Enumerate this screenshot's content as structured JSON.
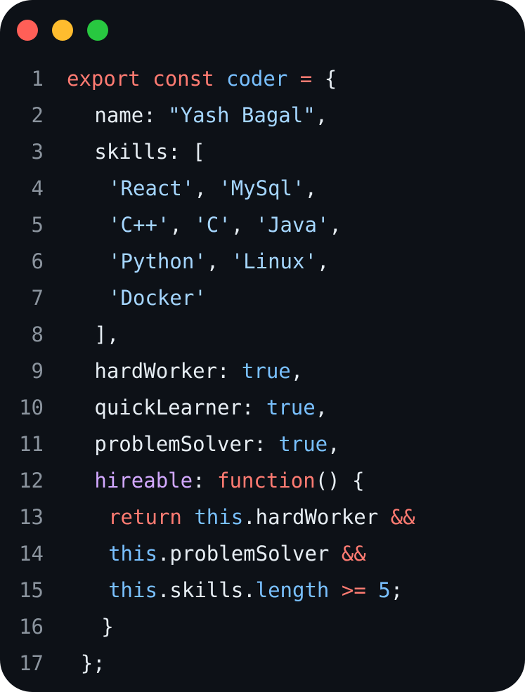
{
  "window": {
    "controls": [
      {
        "name": "close-button",
        "color": "#ff5f57"
      },
      {
        "name": "minimize-button",
        "color": "#febc2e"
      },
      {
        "name": "maximize-button",
        "color": "#28c840"
      }
    ]
  },
  "colors": {
    "keyword": "#ff7b72",
    "identifier": "#79c0ff",
    "property": "#e6edf3",
    "string": "#a5d6ff",
    "purple": "#d2a8ff",
    "text": "#e6edf3"
  },
  "code": {
    "lines": [
      {
        "num": "1",
        "indent": 0,
        "tokens": [
          {
            "t": "export",
            "c": "keyword"
          },
          {
            "t": " ",
            "c": "text"
          },
          {
            "t": "const",
            "c": "keyword"
          },
          {
            "t": " ",
            "c": "text"
          },
          {
            "t": "coder",
            "c": "identifier"
          },
          {
            "t": " ",
            "c": "text"
          },
          {
            "t": "=",
            "c": "keyword"
          },
          {
            "t": " {",
            "c": "text"
          }
        ]
      },
      {
        "num": "2",
        "indent": 4,
        "tokens": [
          {
            "t": "name",
            "c": "property"
          },
          {
            "t": ": ",
            "c": "text"
          },
          {
            "t": "\"Yash Bagal\"",
            "c": "string"
          },
          {
            "t": ",",
            "c": "text"
          }
        ]
      },
      {
        "num": "3",
        "indent": 4,
        "tokens": [
          {
            "t": "skills",
            "c": "property"
          },
          {
            "t": ": [",
            "c": "text"
          }
        ]
      },
      {
        "num": "4",
        "indent": 6,
        "tokens": [
          {
            "t": "'React'",
            "c": "string"
          },
          {
            "t": ", ",
            "c": "text"
          },
          {
            "t": "'MySql'",
            "c": "string"
          },
          {
            "t": ",",
            "c": "text"
          }
        ]
      },
      {
        "num": "5",
        "indent": 6,
        "tokens": [
          {
            "t": "'C++'",
            "c": "string"
          },
          {
            "t": ", ",
            "c": "text"
          },
          {
            "t": "'C'",
            "c": "string"
          },
          {
            "t": ", ",
            "c": "text"
          },
          {
            "t": "'Java'",
            "c": "string"
          },
          {
            "t": ",",
            "c": "text"
          }
        ]
      },
      {
        "num": "6",
        "indent": 6,
        "tokens": [
          {
            "t": "'Python'",
            "c": "string"
          },
          {
            "t": ", ",
            "c": "text"
          },
          {
            "t": "'Linux'",
            "c": "string"
          },
          {
            "t": ",",
            "c": "text"
          }
        ]
      },
      {
        "num": "7",
        "indent": 6,
        "tokens": [
          {
            "t": "'Docker'",
            "c": "string"
          }
        ]
      },
      {
        "num": "8",
        "indent": 4,
        "tokens": [
          {
            "t": "],",
            "c": "text"
          }
        ]
      },
      {
        "num": "9",
        "indent": 4,
        "tokens": [
          {
            "t": "hardWorker",
            "c": "property"
          },
          {
            "t": ": ",
            "c": "text"
          },
          {
            "t": "true",
            "c": "identifier"
          },
          {
            "t": ",",
            "c": "text"
          }
        ]
      },
      {
        "num": "10",
        "indent": 4,
        "tokens": [
          {
            "t": "quickLearner",
            "c": "property"
          },
          {
            "t": ": ",
            "c": "text"
          },
          {
            "t": "true",
            "c": "identifier"
          },
          {
            "t": ",",
            "c": "text"
          }
        ]
      },
      {
        "num": "11",
        "indent": 4,
        "tokens": [
          {
            "t": "problemSolver",
            "c": "property"
          },
          {
            "t": ": ",
            "c": "text"
          },
          {
            "t": "true",
            "c": "identifier"
          },
          {
            "t": ",",
            "c": "text"
          }
        ]
      },
      {
        "num": "12",
        "indent": 4,
        "tokens": [
          {
            "t": "hireable",
            "c": "purple"
          },
          {
            "t": ": ",
            "c": "text"
          },
          {
            "t": "function",
            "c": "keyword"
          },
          {
            "t": "() {",
            "c": "text"
          }
        ]
      },
      {
        "num": "13",
        "indent": 6,
        "tokens": [
          {
            "t": "return",
            "c": "keyword"
          },
          {
            "t": " ",
            "c": "text"
          },
          {
            "t": "this",
            "c": "identifier"
          },
          {
            "t": ".hardWorker ",
            "c": "text"
          },
          {
            "t": "&&",
            "c": "keyword"
          }
        ]
      },
      {
        "num": "14",
        "indent": 6,
        "tokens": [
          {
            "t": "this",
            "c": "identifier"
          },
          {
            "t": ".problemSolver ",
            "c": "text"
          },
          {
            "t": "&&",
            "c": "keyword"
          }
        ]
      },
      {
        "num": "15",
        "indent": 6,
        "tokens": [
          {
            "t": "this",
            "c": "identifier"
          },
          {
            "t": ".skills.",
            "c": "text"
          },
          {
            "t": "length",
            "c": "identifier"
          },
          {
            "t": " ",
            "c": "text"
          },
          {
            "t": ">=",
            "c": "keyword"
          },
          {
            "t": " ",
            "c": "text"
          },
          {
            "t": "5",
            "c": "identifier"
          },
          {
            "t": ";",
            "c": "text"
          }
        ]
      },
      {
        "num": "16",
        "indent": 5,
        "tokens": [
          {
            "t": "}",
            "c": "text"
          }
        ]
      },
      {
        "num": "17",
        "indent": 2,
        "tokens": [
          {
            "t": "};",
            "c": "text"
          }
        ]
      }
    ]
  }
}
